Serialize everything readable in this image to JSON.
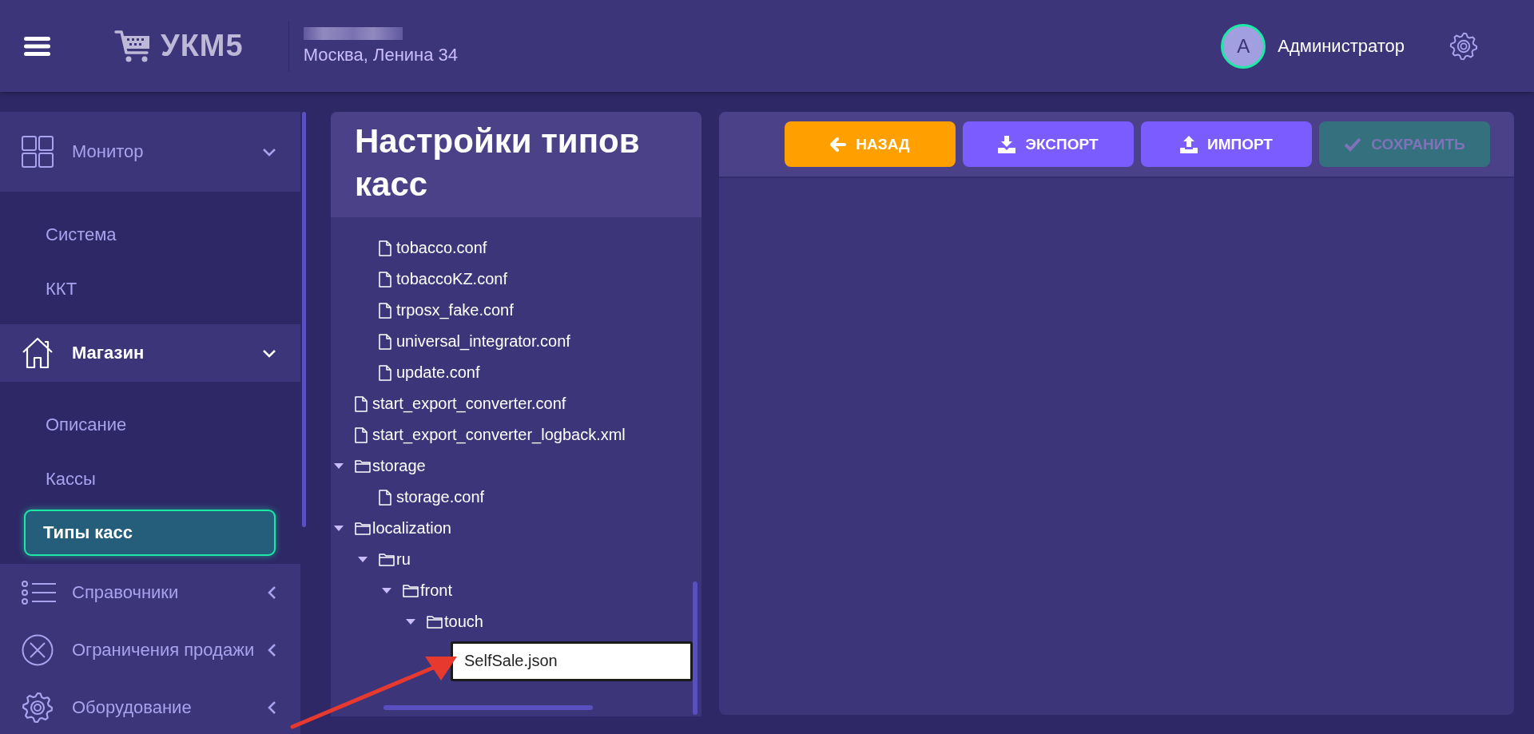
{
  "header": {
    "logo": "УКМ5",
    "address": "Москва, Ленина 34",
    "user": {
      "initial": "А",
      "name": "Администратор"
    }
  },
  "sidebar": {
    "sections": [
      {
        "label": "Монитор",
        "kind": "grid",
        "active": false,
        "expanded": true,
        "children": [
          {
            "label": "Система",
            "selected": false
          },
          {
            "label": "ККТ",
            "selected": false
          }
        ]
      },
      {
        "label": "Магазин",
        "kind": "home",
        "active": true,
        "expanded": true,
        "children": [
          {
            "label": "Описание",
            "selected": false
          },
          {
            "label": "Кассы",
            "selected": false
          },
          {
            "label": "Типы касс",
            "selected": true
          }
        ]
      },
      {
        "label": "Справочники",
        "kind": "list",
        "active": false,
        "expanded": false
      },
      {
        "label": "Ограничения продажи",
        "kind": "cross",
        "active": false,
        "expanded": false
      },
      {
        "label": "Оборудование",
        "kind": "gear",
        "active": false,
        "expanded": false
      }
    ]
  },
  "tree_panel": {
    "title": "Настройки типов касс",
    "nodes": [
      {
        "children": [
          {
            "kind": "file",
            "label": "tobacco.conf"
          },
          {
            "kind": "file",
            "label": "tobaccoKZ.conf"
          },
          {
            "kind": "file",
            "label": "trposx_fake.conf"
          },
          {
            "kind": "file",
            "label": "universal_integrator.conf"
          },
          {
            "kind": "file",
            "label": "update.conf"
          }
        ]
      },
      {
        "kind": "file",
        "label": "start_export_converter.conf"
      },
      {
        "kind": "file",
        "label": "start_export_converter_logback.xml"
      },
      {
        "kind": "folder",
        "label": "storage",
        "expanded": true,
        "children": [
          {
            "kind": "file",
            "label": "storage.conf"
          }
        ]
      },
      {
        "kind": "folder",
        "label": "localization",
        "expanded": true,
        "children": [
          {
            "kind": "folder",
            "label": "ru",
            "expanded": true,
            "children": [
              {
                "kind": "folder",
                "label": "front",
                "expanded": true,
                "children": [
                  {
                    "kind": "folder",
                    "label": "touch",
                    "expanded": true,
                    "children": [
                      {
                        "kind": "rename",
                        "label": "SelfSale.json"
                      }
                    ]
                  }
                ]
              }
            ]
          }
        ]
      }
    ]
  },
  "toolbar": {
    "buttons": [
      {
        "label": "НАЗАД",
        "kind": "back",
        "disabled": false
      },
      {
        "label": "ЭКСПОРТ",
        "kind": "export",
        "disabled": false
      },
      {
        "label": "ИМПОРТ",
        "kind": "import",
        "disabled": false
      },
      {
        "label": "СОХРАНИТЬ",
        "kind": "save",
        "disabled": true
      }
    ]
  }
}
